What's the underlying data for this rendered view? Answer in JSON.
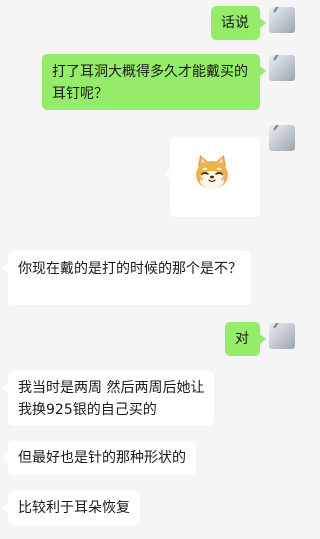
{
  "chat": {
    "messages": [
      {
        "side": "out",
        "text": "话说"
      },
      {
        "side": "out",
        "text": "打了耳洞大概得多久才能戴买的耳钉呢？"
      },
      {
        "side": "out",
        "type": "sticker",
        "sticker": "shiba-dog-sticker"
      },
      {
        "side": "in",
        "text": "你现在戴的是打的时候的那个是不？"
      },
      {
        "side": "out",
        "text": "对"
      },
      {
        "side": "in",
        "text": "我当时是两周 然后两周后她让我换925银的自己买的"
      },
      {
        "side": "in",
        "text": "但最好也是针的那种形状的"
      },
      {
        "side": "in",
        "text": "比较利于耳朵恢复"
      }
    ]
  },
  "colors": {
    "background": "#f5f5f5",
    "outgoing_bubble": "#95ec69",
    "incoming_bubble": "#ffffff",
    "text": "#191919"
  }
}
